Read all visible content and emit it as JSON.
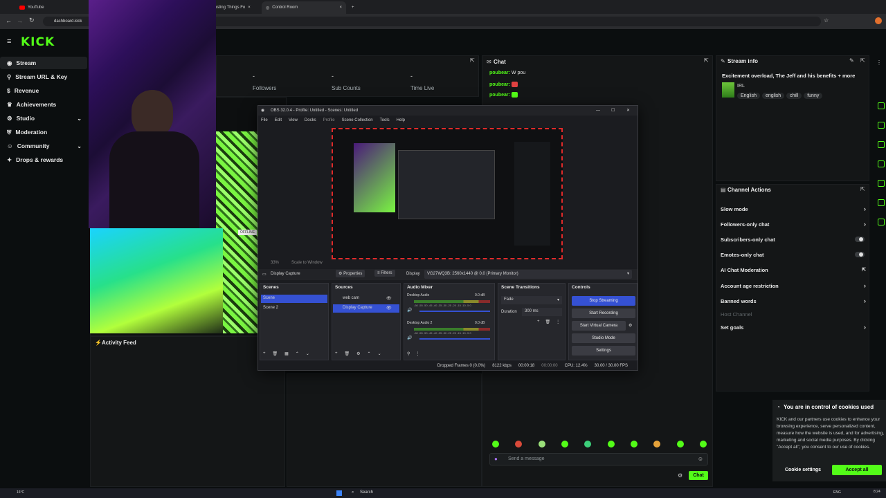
{
  "browser": {
    "tabs": [
      {
        "label": "YouTube"
      },
      {
        "label": "usting Things Fo"
      },
      {
        "label": "Control Room"
      }
    ],
    "url": "dashboard.kick"
  },
  "brand": {
    "logo": "KICK",
    "accent": "#53fc18"
  },
  "sidebar": {
    "items": [
      {
        "label": "Stream",
        "icon": "broadcast-icon"
      },
      {
        "label": "Stream URL & Key",
        "icon": "link-icon"
      },
      {
        "label": "Revenue",
        "icon": "dollar-icon"
      },
      {
        "label": "Achievements",
        "icon": "trophy-icon"
      },
      {
        "label": "Studio",
        "icon": "gear-icon"
      },
      {
        "label": "Moderation",
        "icon": "shield-icon"
      },
      {
        "label": "Community",
        "icon": "users-icon"
      },
      {
        "label": "Drops & rewards",
        "icon": "gift-icon"
      }
    ]
  },
  "stats": {
    "followers_value": "-",
    "followers_label": "Followers",
    "subs_value": "-",
    "subs_label": "Sub Counts",
    "time_value": "-",
    "time_label": "Time Live"
  },
  "activity": {
    "title": "Activity Feed"
  },
  "offline_badge": "OFFLINE",
  "chat": {
    "title": "Chat",
    "messages": [
      {
        "user": "poubear:",
        "text": "W pou"
      },
      {
        "user": "poubear:",
        "text": ""
      },
      {
        "user": "poubear:",
        "text": ""
      }
    ],
    "placeholder": "Send a message",
    "send_label": "Chat"
  },
  "obs": {
    "title": "OBS 32.0.4 - Profile: Untitled - Scenes: Untitled",
    "menu": [
      "File",
      "Edit",
      "View",
      "Docks",
      "Profile",
      "Scene Collection",
      "Tools",
      "Help"
    ],
    "zoom_label": "33%",
    "scale_label": "Scale to Window",
    "source_name": "Display Capture",
    "properties": "Properties",
    "filters": "Filters",
    "display_label": "Display",
    "display_value": "VG27WQ3B: 2560x1440 @ 0,0 (Primary Monitor)",
    "scenes_title": "Scenes",
    "scenes": [
      "Scene",
      "Scene 2"
    ],
    "sources_title": "Sources",
    "sources": [
      "web cam",
      "Display Capture"
    ],
    "mixer_title": "Audio Mixer",
    "tracks": [
      {
        "name": "Desktop Audio",
        "db": "0.0 dB"
      },
      {
        "name": "Desktop Audio 2",
        "db": "0.0 dB"
      }
    ],
    "meter_ticks": "-60 -55 -50 -45 -40 -35 -30 -25 -20 -15 -10 -5 0",
    "transitions_title": "Scene Transitions",
    "transition": "Fade",
    "duration_label": "Duration",
    "duration_value": "300 ms",
    "controls_title": "Controls",
    "controls": [
      "Stop Streaming",
      "Start Recording",
      "Start Virtual Camera",
      "Studio Mode",
      "Settings"
    ],
    "status": {
      "dropped": "Dropped Frames 0 (0.0%)",
      "kbps": "8122 kbps",
      "live": "00:00:18",
      "rec": "00:00:00",
      "cpu": "CPU: 12.4%",
      "fps": "30.00 / 30.00 FPS"
    }
  },
  "stream_info": {
    "title": "Stream info",
    "stream_title": "Excitement overload, The Jeff and his benefits + more",
    "category": "IRL",
    "tags": [
      "English",
      "english",
      "chill",
      "funny"
    ]
  },
  "channel_actions": {
    "title": "Channel Actions",
    "items": [
      {
        "label": "Slow mode",
        "kind": "arrow"
      },
      {
        "label": "Followers-only chat",
        "kind": "arrow"
      },
      {
        "label": "Subscribers-only chat",
        "kind": "toggle"
      },
      {
        "label": "Emotes-only chat",
        "kind": "toggle"
      },
      {
        "label": "AI Chat Moderation",
        "kind": "external"
      },
      {
        "label": "Account age restriction",
        "kind": "arrow"
      },
      {
        "label": "Banned words",
        "kind": "arrow"
      },
      {
        "label": "Host Channel",
        "kind": "disabled"
      },
      {
        "label": "Set goals",
        "kind": "arrow"
      }
    ]
  },
  "cookies": {
    "title": "You are in control of cookies used",
    "body": "KICK and our partners use cookies to enhance your browsing experience, serve personalized content, measure how the website is used, and for advertising, marketing and social media purposes. By clicking \"Accept all\", you consent to our use of cookies.",
    "settings": "Cookie settings",
    "accept": "Accept all"
  },
  "taskbar": {
    "weather": "16°C",
    "search": "Search",
    "lang": "ENG",
    "time": "8:24"
  }
}
